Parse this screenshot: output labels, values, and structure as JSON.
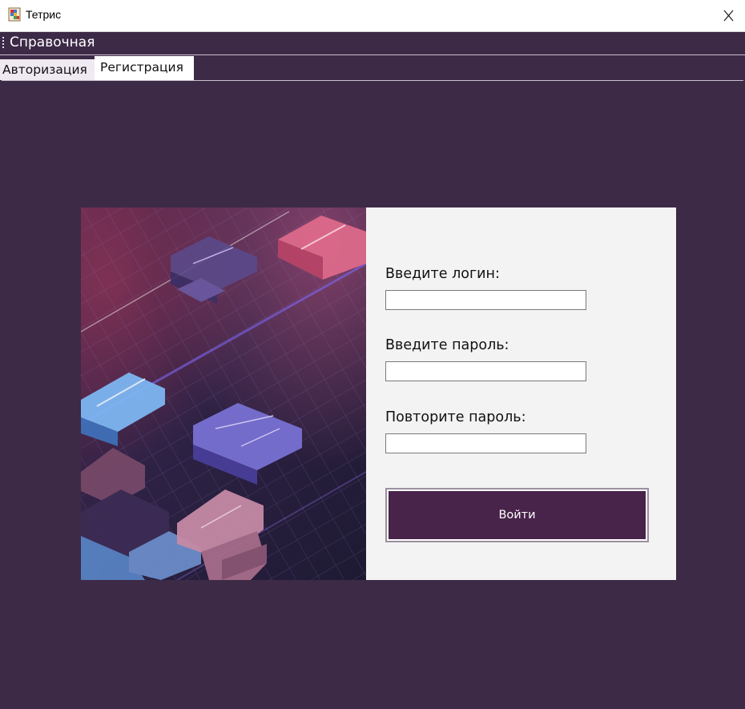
{
  "window": {
    "title": "Тетрис",
    "close_icon": "close-icon",
    "app_icon": "tetris-app-icon"
  },
  "menubar": {
    "items": [
      {
        "label": "Справочная"
      }
    ]
  },
  "tabs": [
    {
      "label": "Авторизация",
      "selected": false
    },
    {
      "label": "Регистрация",
      "selected": true
    }
  ],
  "form": {
    "login_label": "Введите логин:",
    "login_value": "",
    "password_label": "Введите пароль:",
    "password_value": "",
    "repeat_label": "Повторите пароль:",
    "repeat_value": "",
    "submit_label": "Войти"
  },
  "colors": {
    "background": "#3d2a47",
    "form_background": "#f3f3f3",
    "button": "#48234a",
    "text_light": "#ffffff"
  }
}
